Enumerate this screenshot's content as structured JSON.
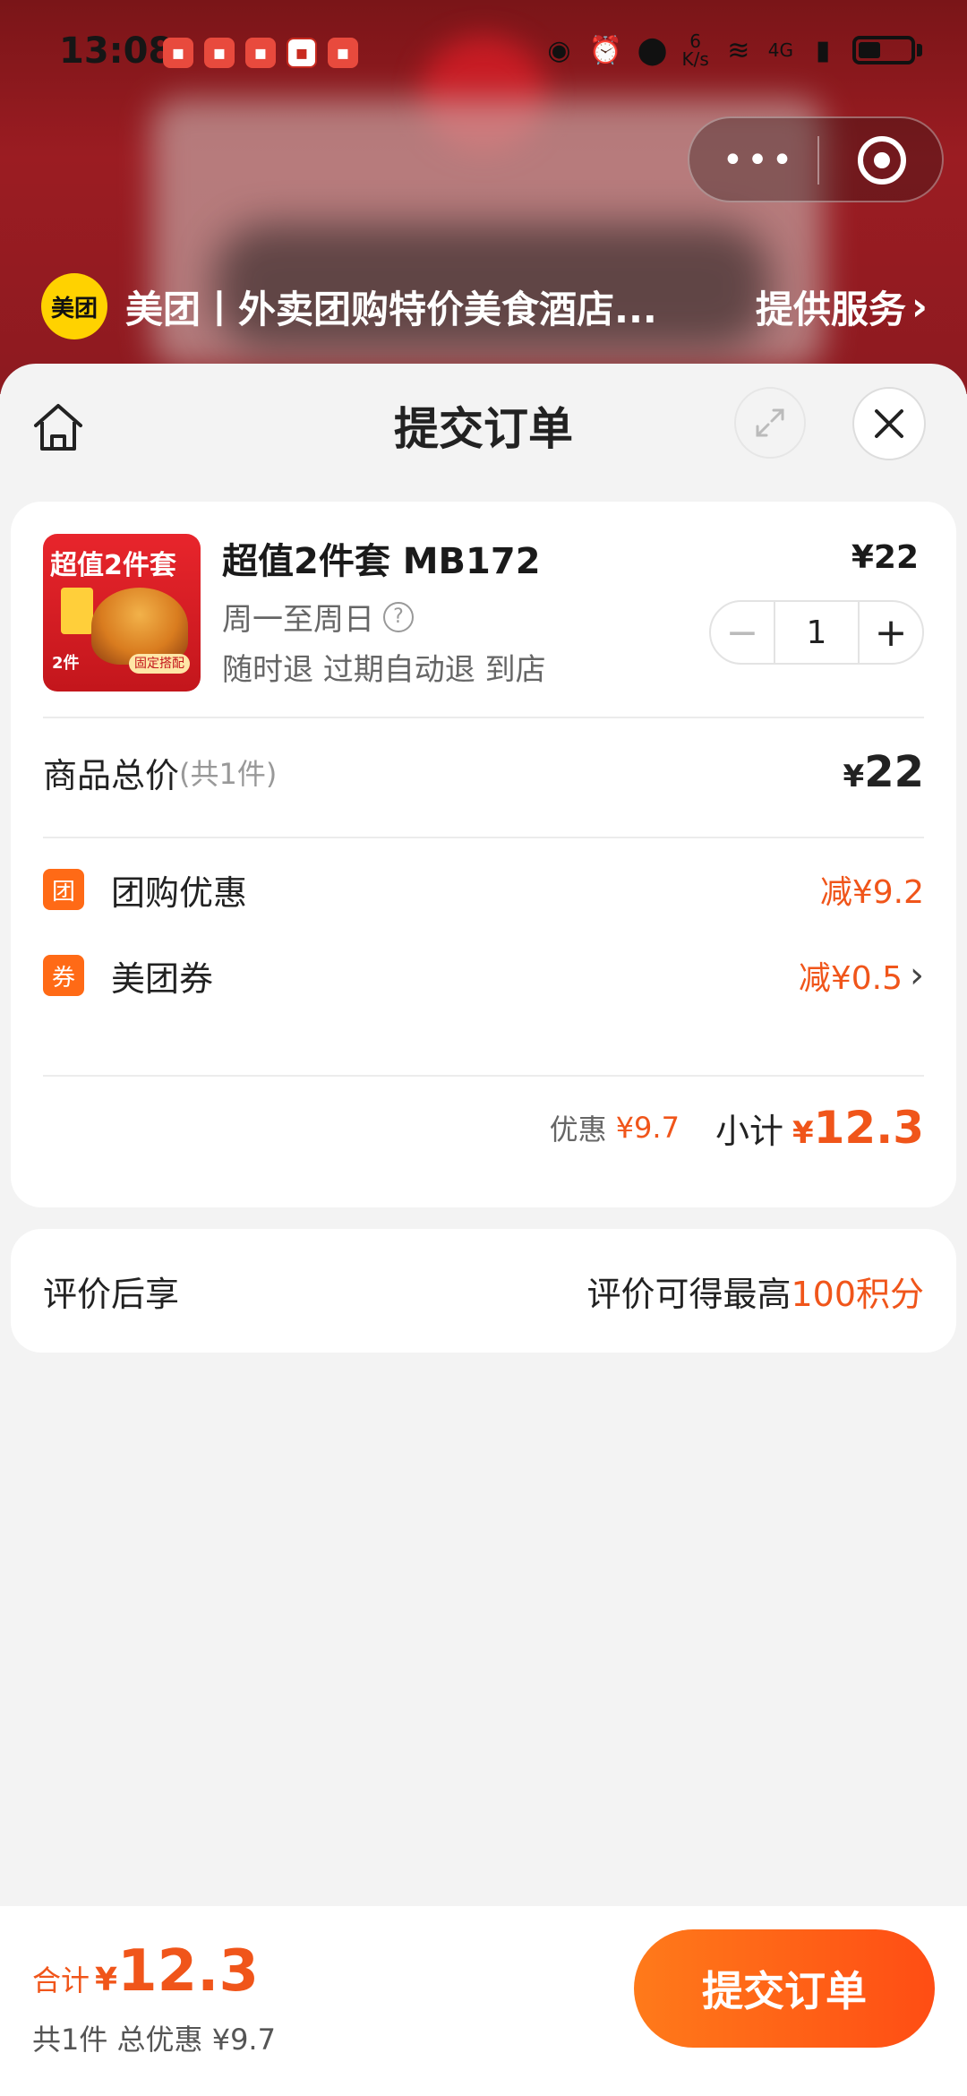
{
  "status_bar": {
    "time": "13:08",
    "net_speed_top": "6",
    "net_speed_unit": "K/s",
    "network": "4G"
  },
  "mini_program": {
    "logo_text": "美团",
    "title": "美团丨外卖团购特价美食酒店...",
    "service_label": "提供服务"
  },
  "sheet": {
    "title": "提交订单"
  },
  "order": {
    "thumb_text": "超值2件套",
    "thumb_badge": "2件",
    "thumb_chip": "固定搭配",
    "name": "超值2件套 MB172",
    "price": "¥22",
    "days": "周一至周日",
    "tags": "随时退 过期自动退 到店",
    "quantity": "1",
    "total_label": "商品总价",
    "total_count": "(共1件)",
    "total_yen": "¥",
    "total_value": "22",
    "discounts": [
      {
        "badge": "团",
        "label": "团购优惠",
        "value": "减¥9.2"
      },
      {
        "badge": "券",
        "label": "美团券",
        "value": "减¥0.5"
      }
    ],
    "subtotal": {
      "discount_label": "优惠",
      "discount_value": "¥9.7",
      "label": "小计",
      "yen": "¥",
      "value": "12.3"
    }
  },
  "review": {
    "left": "评价后享",
    "right_prefix": "评价可得最高",
    "right_highlight": "100积分"
  },
  "bottom": {
    "total_label": "合计",
    "total_yen": "¥",
    "total_value": "12.3",
    "summary": "共1件 总优惠 ¥9.7",
    "submit_label": "提交订单"
  },
  "colors": {
    "accent": "#f0551a",
    "submit_start": "#ff7a1a",
    "submit_end": "#ff4d14",
    "header_bg": "#8d1a20"
  }
}
